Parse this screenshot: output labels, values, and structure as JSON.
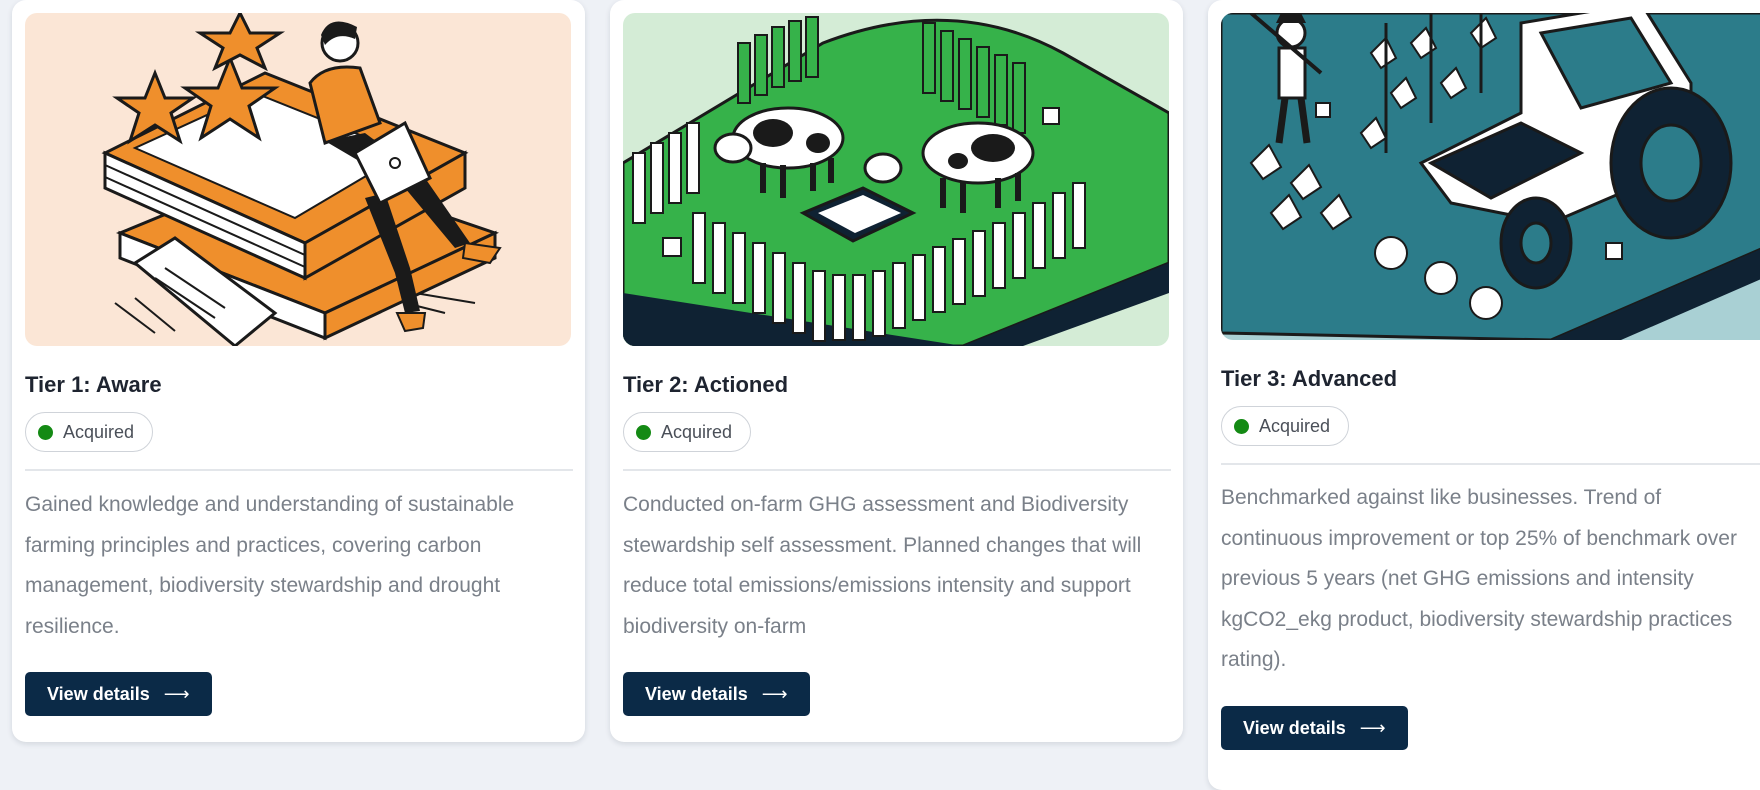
{
  "cards": [
    {
      "title": "Tier 1: Aware",
      "status": "Acquired",
      "description": "Gained knowledge and understanding of sustainable farming principles and practices, covering carbon management, biodiversity stewardship and drought resilience.",
      "button_label": "View details",
      "button_icon": "arrow-right-icon",
      "illustration": "person-with-laptop-on-books-illustration",
      "illustration_bg": "#fbe6d6",
      "accent": "#ef8f2c"
    },
    {
      "title": "Tier 2: Actioned",
      "status": "Acquired",
      "description": "Conducted on-farm GHG assessment and Biodiversity stewardship self assessment. Planned changes that will reduce total emissions/emissions intensity and support biodiversity on-farm",
      "button_label": "View details",
      "button_icon": "arrow-right-icon",
      "illustration": "cows-in-fenced-paddock-illustration",
      "illustration_bg": "#d4ecd6",
      "accent": "#36b24a"
    },
    {
      "title": "Tier 3: Advanced",
      "status": "Acquired",
      "description": "Benchmarked against like businesses. Trend of continuous improvement or top 25% of benchmark over previous 5 years (net GHG emissions and intensity kgCO2_ekg product, biodiversity stewardship practices rating).",
      "button_label": "View details",
      "button_icon": "arrow-right-icon",
      "illustration": "farmer-and-tractor-illustration",
      "illustration_bg": "#a9d0d4",
      "accent": "#2c7c8a"
    }
  ],
  "colors": {
    "status_dot": "#148a14",
    "button_bg": "#0b2a47",
    "title_text": "#1e2430",
    "body_text": "#7a8089"
  }
}
